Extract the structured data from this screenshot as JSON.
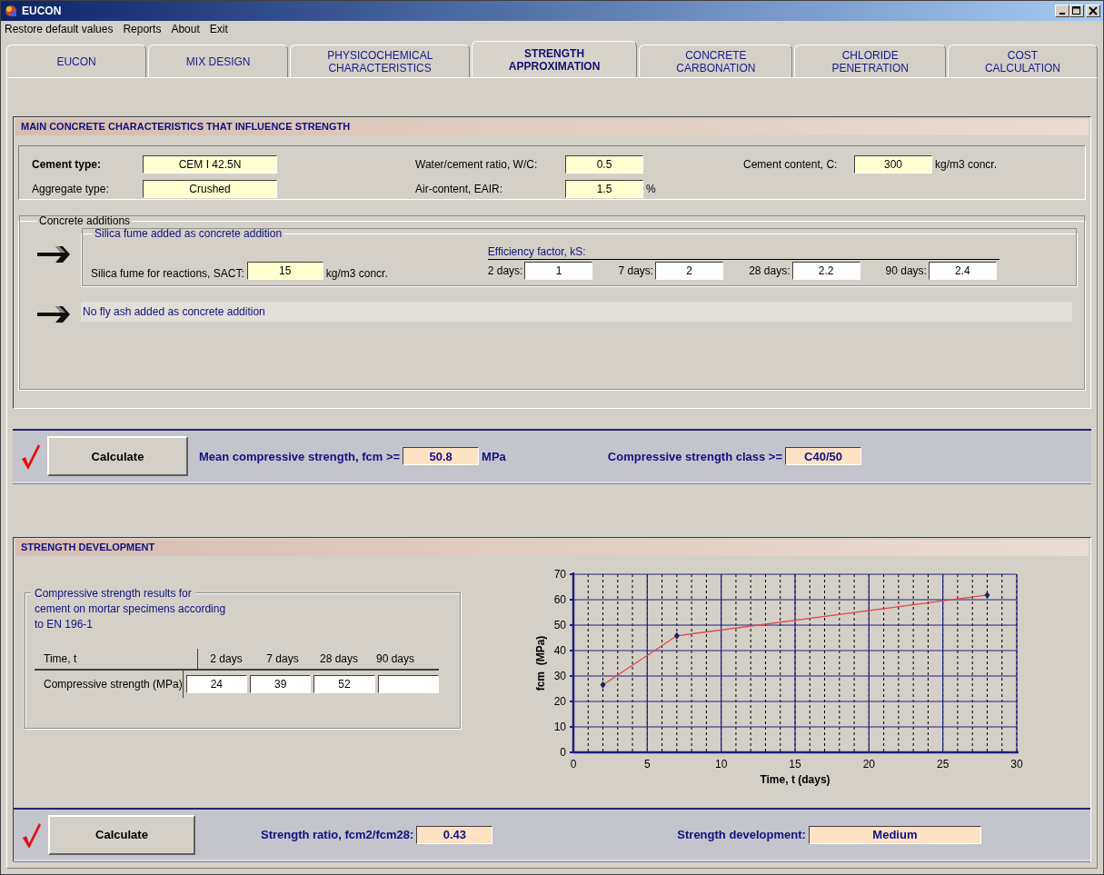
{
  "window": {
    "title": "EUCON"
  },
  "menu": [
    "Restore default values",
    "Reports",
    "About",
    "Exit"
  ],
  "tabs": [
    {
      "label": "EUCON",
      "selected": false
    },
    {
      "label": "MIX DESIGN",
      "selected": false
    },
    {
      "label": "PHYSICOCHEMICAL CHARACTERISTICS",
      "selected": false
    },
    {
      "label": "STRENGTH APPROXIMATION",
      "selected": true
    },
    {
      "label": "CONCRETE CARBONATION",
      "selected": false
    },
    {
      "label": "CHLORIDE PENETRATION",
      "selected": false
    },
    {
      "label": "COST CALCULATION",
      "selected": false
    }
  ],
  "characteristics": {
    "title": "MAIN CONCRETE CHARACTERISTICS THAT INFLUENCE STRENGTH",
    "cement_type": {
      "label": "Cement type:",
      "value": "CEM I 42.5N"
    },
    "aggregate_type": {
      "label": "Aggregate type:",
      "value": "Crushed"
    },
    "wc_ratio": {
      "label": "Water/cement ratio, W/C:",
      "value": "0.5"
    },
    "air_content": {
      "label": "Air-content, EAIR:",
      "value": "1.5",
      "unit": "%"
    },
    "cement_content": {
      "label": "Cement content, C:",
      "value": "300",
      "unit": "kg/m3 concr."
    }
  },
  "additions": {
    "title": "Concrete additions",
    "silica_fume": {
      "title": "Silica fume added as concrete addition",
      "label": "Silica fume for reactions, SACT:",
      "value": "15",
      "unit": "kg/m3 concr.",
      "efficiency_title": "Efficiency factor, kS:",
      "efficiency": [
        {
          "label": "2 days:",
          "value": "1"
        },
        {
          "label": "7 days:",
          "value": "2"
        },
        {
          "label": "28 days:",
          "value": "2.2"
        },
        {
          "label": "90 days:",
          "value": "2.4"
        }
      ]
    },
    "fly_ash": {
      "text": "No fly ash added as concrete addition"
    }
  },
  "calc_strength": {
    "button": "Calculate",
    "results": [
      {
        "label": "Mean compressive strength, fcm >=",
        "value": "50.8",
        "unit": "MPa"
      },
      {
        "label": "Compressive strength class >=",
        "value": "C40/50"
      }
    ]
  },
  "development": {
    "title": "STRENGTH DEVELOPMENT",
    "results_box": {
      "title_lines": [
        "Compressive strength results for",
        "cement on mortar specimens according",
        "to EN 196-1"
      ],
      "columns": [
        "Time, t",
        "2 days",
        "7 days",
        "28 days",
        "90 days"
      ],
      "row_label": "Compressive strength (MPa)",
      "values": [
        "24",
        "39",
        "52"
      ]
    },
    "chart_data": {
      "type": "line",
      "xlabel": "Time, t (days)",
      "ylabel": "fcm  (MPa)",
      "x": [
        2,
        7,
        28
      ],
      "series": [
        {
          "color": "#e04848",
          "marker": "diamond",
          "values": [
            26.5,
            45.8,
            61.8
          ]
        }
      ],
      "grid": true,
      "xlim": [
        0,
        30
      ],
      "ylim": [
        0,
        70
      ],
      "xticks": [
        0,
        5,
        10,
        15,
        20,
        25,
        30
      ],
      "yticks": [
        0,
        10,
        20,
        30,
        40,
        50,
        60,
        70
      ]
    }
  },
  "calc_development": {
    "button": "Calculate",
    "results": [
      {
        "label": "Strength ratio, fcm2/fcm28:",
        "value": "0.43"
      },
      {
        "label": "Strength development:",
        "value": "Medium"
      }
    ]
  }
}
